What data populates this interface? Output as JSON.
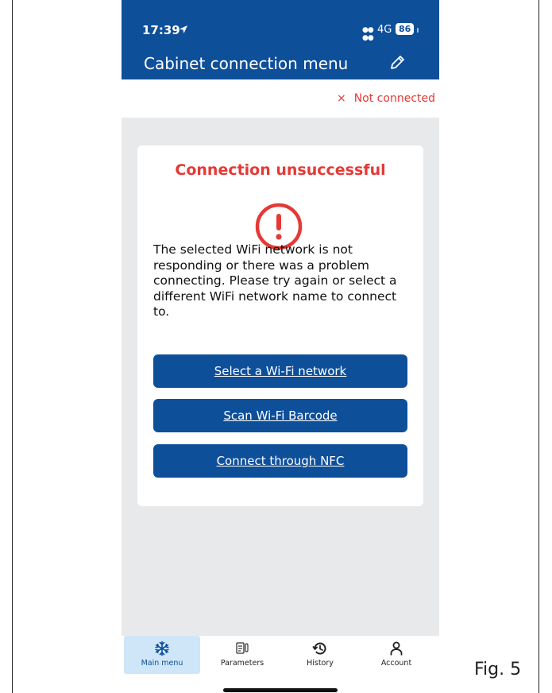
{
  "status_bar": {
    "time": "17:39",
    "network": "4G",
    "battery": "86"
  },
  "header": {
    "title": "Cabinet connection menu"
  },
  "connection": {
    "status_icon": "×",
    "status_text": "Not connected",
    "status_color": "#e53935"
  },
  "dialog": {
    "title": "Connection unsuccessful",
    "message": "The selected WiFi network is not responding or there was a problem connecting. Please try again or select a different WiFi network name to connect to.",
    "buttons": {
      "select_wifi": "Select a Wi-Fi network",
      "scan_barcode": "Scan Wi-Fi Barcode",
      "nfc": "Connect through NFC"
    }
  },
  "tabs": [
    {
      "label": "Main menu",
      "icon": "snowflake-icon",
      "active": true
    },
    {
      "label": "Parameters",
      "icon": "parameters-icon",
      "active": false
    },
    {
      "label": "History",
      "icon": "history-icon",
      "active": false
    },
    {
      "label": "Account",
      "icon": "account-icon",
      "active": false
    }
  ],
  "figure_label": "Fig. 5",
  "colors": {
    "brand_blue": "#0e4f9a",
    "error_red": "#e53935",
    "background_gray": "#e8e9ea",
    "active_tab": "#cfe6f8"
  }
}
